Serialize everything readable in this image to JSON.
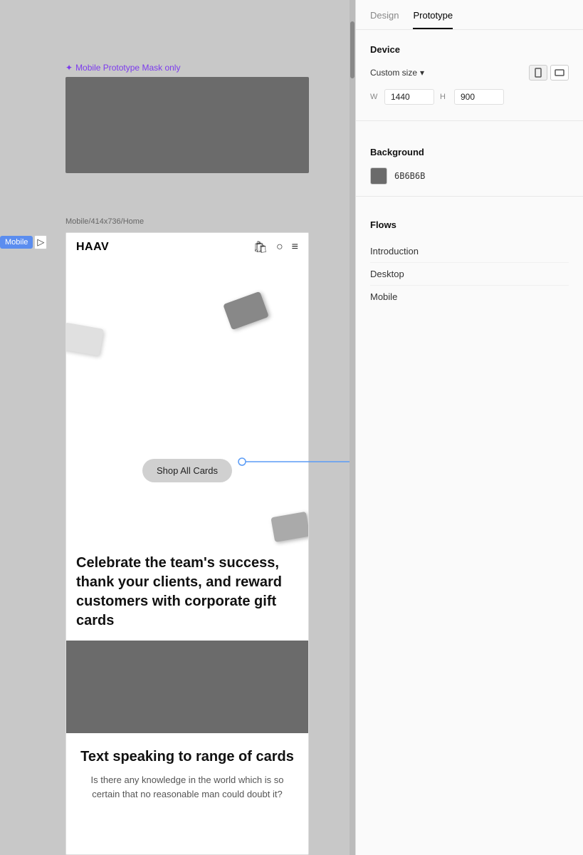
{
  "tabs": {
    "design": "Design",
    "prototype": "Prototype"
  },
  "active_tab": "Prototype",
  "prototype_mask_label": "Mobile Prototype Mask only",
  "frame_label": "Mobile/414x736/Home",
  "mobile_badge": "Mobile",
  "navbar_brand": "HAAV",
  "shop_btn_label": "Shop All Cards",
  "hero_text": "Celebrate the team's success, thank your clients, and reward customers with corporate gift cards",
  "bottom_text_heading": "Text speaking to range of cards",
  "bottom_text_body": "Is there any knowledge in the world which is so certain that no reasonable man could doubt it?",
  "device_section": {
    "title": "Device",
    "size_label": "Custom size",
    "w_label": "W",
    "h_label": "H",
    "width_value": "1440",
    "height_value": "900"
  },
  "background_section": {
    "title": "Background",
    "color_hex": "6B6B6B",
    "color_value": "#6b6b6b"
  },
  "flows_section": {
    "title": "Flows",
    "items": [
      {
        "label": "Introduction"
      },
      {
        "label": "Desktop"
      },
      {
        "label": "Mobile"
      }
    ]
  }
}
